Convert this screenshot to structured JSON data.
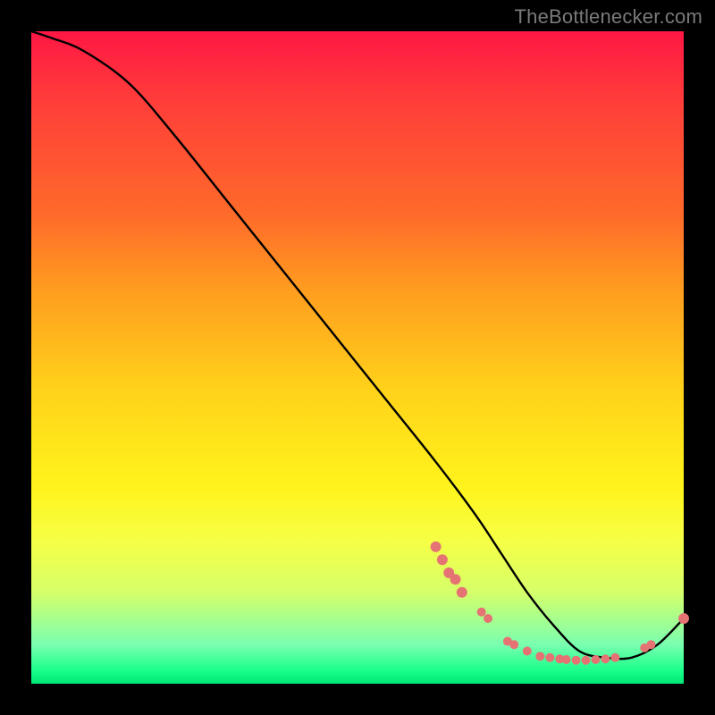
{
  "watermark": "TheBottlenecker.com",
  "chart_data": {
    "type": "line",
    "title": "",
    "xlabel": "",
    "ylabel": "",
    "xlim": [
      0,
      100
    ],
    "ylim": [
      0,
      100
    ],
    "series": [
      {
        "name": "bottleneck-curve",
        "x": [
          0,
          3,
          8,
          15,
          22,
          30,
          38,
          46,
          54,
          62,
          68,
          72,
          76,
          80,
          84,
          88,
          92,
          96,
          100
        ],
        "values": [
          100,
          99,
          97,
          92,
          84,
          74,
          64,
          54,
          44,
          34,
          26,
          20,
          14,
          9,
          5,
          4,
          4,
          6,
          10
        ]
      }
    ],
    "markers": {
      "name": "highlighted-points",
      "color": "#e57373",
      "points": [
        {
          "x": 62,
          "y": 21,
          "r": 6
        },
        {
          "x": 63,
          "y": 19,
          "r": 6
        },
        {
          "x": 64,
          "y": 17,
          "r": 6
        },
        {
          "x": 65,
          "y": 16,
          "r": 6
        },
        {
          "x": 66,
          "y": 14,
          "r": 6
        },
        {
          "x": 69,
          "y": 11,
          "r": 5
        },
        {
          "x": 70,
          "y": 10,
          "r": 5
        },
        {
          "x": 73,
          "y": 6.5,
          "r": 5
        },
        {
          "x": 74,
          "y": 6,
          "r": 5
        },
        {
          "x": 76,
          "y": 5,
          "r": 5
        },
        {
          "x": 78,
          "y": 4.2,
          "r": 5
        },
        {
          "x": 79.5,
          "y": 4,
          "r": 5
        },
        {
          "x": 81,
          "y": 3.8,
          "r": 5
        },
        {
          "x": 82,
          "y": 3.7,
          "r": 5
        },
        {
          "x": 83.5,
          "y": 3.6,
          "r": 5
        },
        {
          "x": 85,
          "y": 3.6,
          "r": 5
        },
        {
          "x": 86.5,
          "y": 3.7,
          "r": 5
        },
        {
          "x": 88,
          "y": 3.8,
          "r": 5
        },
        {
          "x": 89.5,
          "y": 4.0,
          "r": 5
        },
        {
          "x": 94,
          "y": 5.5,
          "r": 5
        },
        {
          "x": 95,
          "y": 6.0,
          "r": 5
        },
        {
          "x": 100,
          "y": 10,
          "r": 6
        }
      ]
    }
  }
}
